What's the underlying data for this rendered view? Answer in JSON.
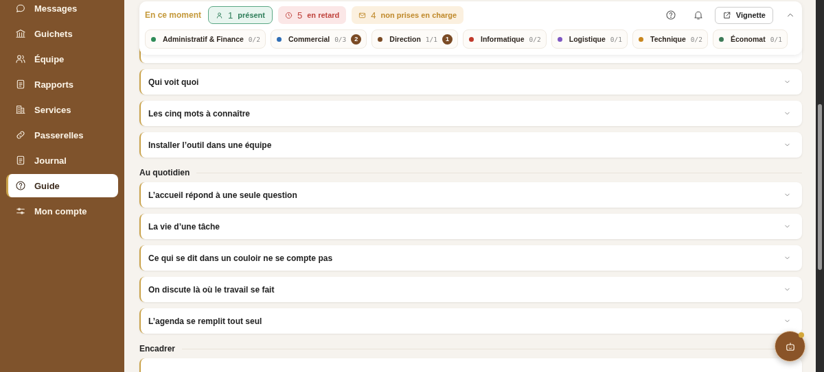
{
  "sidebar": {
    "items": [
      {
        "label": "Messages",
        "selected": false
      },
      {
        "label": "Guichets",
        "selected": false
      },
      {
        "label": "Équipe",
        "selected": false
      },
      {
        "label": "Rapports",
        "selected": false
      },
      {
        "label": "Services",
        "selected": false
      },
      {
        "label": "Passerelles",
        "selected": false
      },
      {
        "label": "Journal",
        "selected": false
      },
      {
        "label": "Guide",
        "selected": true
      },
      {
        "label": "Mon compte",
        "selected": false
      }
    ]
  },
  "status_panel": {
    "title": "En ce moment",
    "stats": [
      {
        "kind": "present",
        "value": "1",
        "label": "présent"
      },
      {
        "kind": "late",
        "value": "5",
        "label": "en retard"
      },
      {
        "kind": "unassigned",
        "value": "4",
        "label": "non prises en charge"
      }
    ],
    "button": "Vignette",
    "teams": [
      {
        "name": "Administratif & Finance",
        "color": "#2e8b57",
        "count": "0/2"
      },
      {
        "name": "Commercial",
        "color": "#2f6db5",
        "count": "0/3",
        "badge": "2"
      },
      {
        "name": "Direction",
        "color": "#7a4a24",
        "count": "1/1",
        "badge": "1"
      },
      {
        "name": "Informatique",
        "color": "#c0392b",
        "count": "0/2"
      },
      {
        "name": "Logistique",
        "color": "#7e57c2",
        "count": "0/1"
      },
      {
        "name": "Technique",
        "color": "#c8861e",
        "count": "0/2"
      },
      {
        "name": "Économat",
        "color": "#3d7a57",
        "count": "0/1"
      }
    ]
  },
  "guide": {
    "top_items": [
      "Qui voit quoi",
      "Les cinq mots à connaître",
      "Installer l’outil dans une équipe"
    ],
    "sections": [
      {
        "title": "Au quotidien",
        "items": [
          "L’accueil répond à une seule question",
          "La vie d’une tâche",
          "Ce qui se dit dans un couloir ne se compte pas",
          "On discute là où le travail se fait",
          "L’agenda se remplit tout seul"
        ]
      },
      {
        "title": "Encadrer"
      }
    ]
  }
}
